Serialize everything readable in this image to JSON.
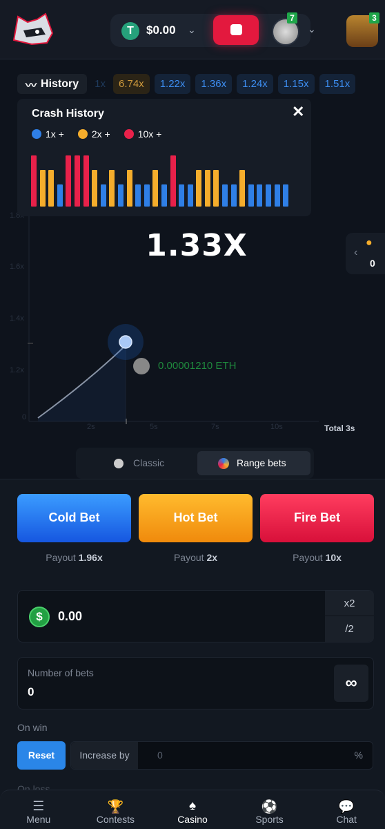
{
  "header": {
    "balance": "$0.00",
    "coin_symbol": "T",
    "level_badge": "7",
    "chest_badge": "3"
  },
  "history": {
    "label": "History",
    "chips": [
      {
        "value": "1x",
        "style": "fade"
      },
      {
        "value": "6.74x",
        "style": "gold"
      },
      {
        "value": "1.22x",
        "style": "blue"
      },
      {
        "value": "1.36x",
        "style": "blue"
      },
      {
        "value": "1.24x",
        "style": "blue"
      },
      {
        "value": "1.15x",
        "style": "blue"
      },
      {
        "value": "1.51x",
        "style": "blue"
      }
    ]
  },
  "crash_history": {
    "title": "Crash History",
    "close": "✕",
    "legend": [
      {
        "label": "1x +",
        "color": "#2f7fe6"
      },
      {
        "label": "2x +",
        "color": "#f5ad2c"
      },
      {
        "label": "10x +",
        "color": "#e8214a"
      }
    ],
    "bars": [
      "10x",
      "2x",
      "2x",
      "1x",
      "10x",
      "10x",
      "10x",
      "2x",
      "1x",
      "2x",
      "1x",
      "2x",
      "1x",
      "1x",
      "2x",
      "1x",
      "10x",
      "1x",
      "1x",
      "2x",
      "2x",
      "2x",
      "1x",
      "1x",
      "2x",
      "1x",
      "1x",
      "1x",
      "1x",
      "1x"
    ]
  },
  "graph": {
    "multiplier": "1.33X",
    "y_ticks": [
      "1.8x",
      "1.6x",
      "1.4x",
      "1.2x",
      "0"
    ],
    "x_ticks": [
      "2s",
      "5s",
      "7s",
      "10s"
    ],
    "total": "Total 3s",
    "player_win": "0.00001210 ETH",
    "players_count": "0"
  },
  "modes": {
    "classic": "Classic",
    "range": "Range bets"
  },
  "bets": [
    {
      "label": "Cold Bet",
      "payout_label": "Payout",
      "payout": "1.96x"
    },
    {
      "label": "Hot Bet",
      "payout_label": "Payout",
      "payout": "2x"
    },
    {
      "label": "Fire Bet",
      "payout_label": "Payout",
      "payout": "10x"
    }
  ],
  "amount": {
    "value": "0.00",
    "double": "x2",
    "half": "/2"
  },
  "number_of_bets": {
    "label": "Number of bets",
    "value": "0",
    "infinite": "∞"
  },
  "on_win": {
    "label": "On win",
    "reset": "Reset",
    "increase_by": "Increase by",
    "value": "0",
    "unit": "%"
  },
  "on_loss": {
    "label": "On loss"
  },
  "nav": [
    {
      "label": "Menu",
      "icon": "☰"
    },
    {
      "label": "Contests",
      "icon": "🏆"
    },
    {
      "label": "Casino",
      "icon": "♠"
    },
    {
      "label": "Sports",
      "icon": "⚽"
    },
    {
      "label": "Chat",
      "icon": "💬"
    }
  ]
}
